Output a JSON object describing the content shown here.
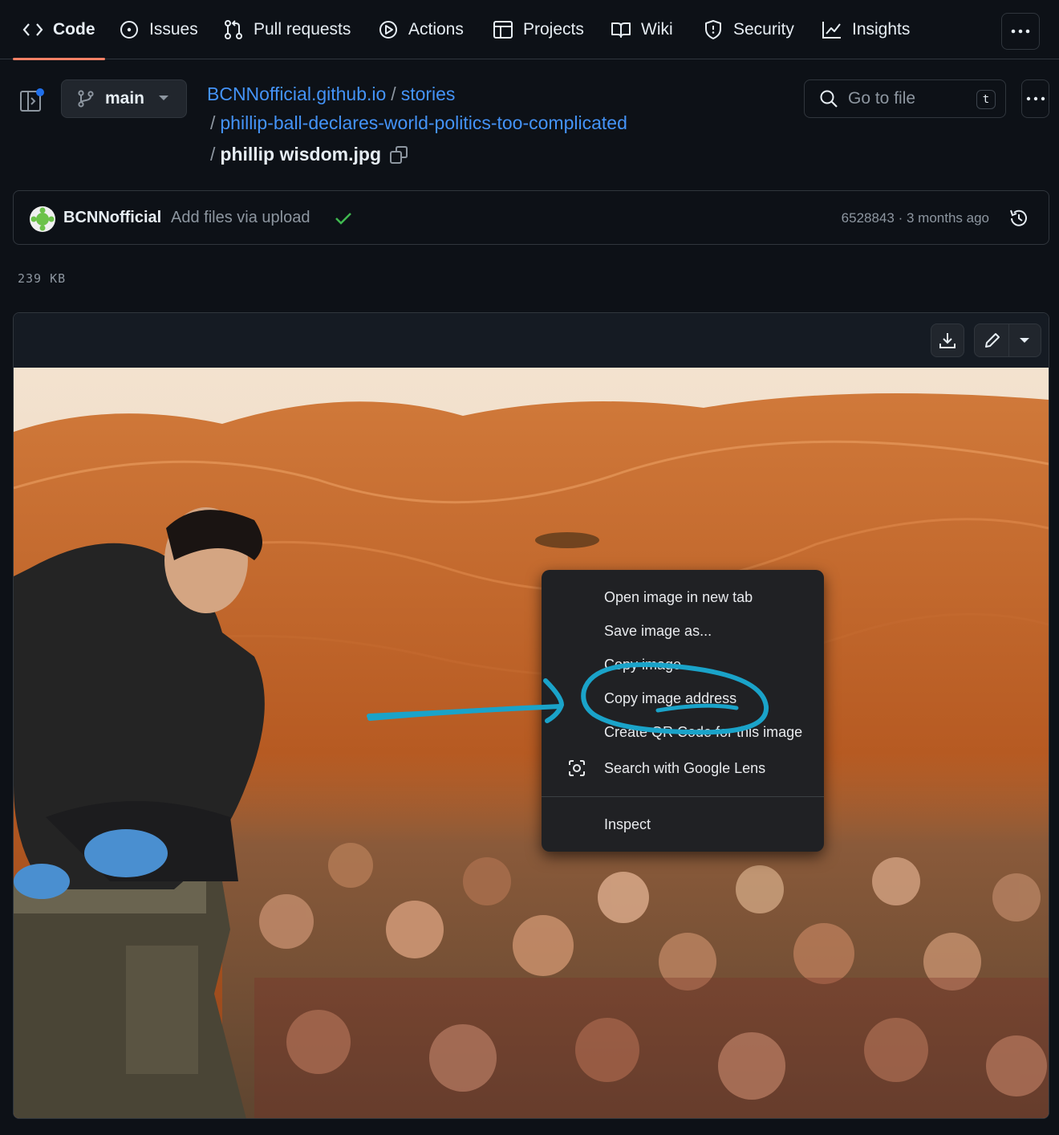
{
  "nav": {
    "tabs": [
      {
        "label": "Code",
        "icon": "code-icon",
        "active": true
      },
      {
        "label": "Issues",
        "icon": "issue-icon"
      },
      {
        "label": "Pull requests",
        "icon": "pull-request-icon"
      },
      {
        "label": "Actions",
        "icon": "play-icon"
      },
      {
        "label": "Projects",
        "icon": "table-icon"
      },
      {
        "label": "Wiki",
        "icon": "book-icon"
      },
      {
        "label": "Security",
        "icon": "shield-icon"
      },
      {
        "label": "Insights",
        "icon": "graph-icon"
      }
    ]
  },
  "branch": {
    "name": "main"
  },
  "breadcrumb": {
    "repo": "BCNNofficial.github.io",
    "sep": "/",
    "folder": "stories",
    "subfolder": "phillip-ball-declares-world-politics-too-complicated",
    "file": "phillip wisdom.jpg"
  },
  "search": {
    "placeholder": "Go to file",
    "shortcut": "t"
  },
  "commit": {
    "author": "BCNNofficial",
    "message": "Add files via upload",
    "sha": "6528843",
    "dot": "·",
    "time": "3 months ago"
  },
  "file": {
    "size": "239 KB"
  },
  "context_menu": {
    "items": [
      {
        "label": "Open image in new tab"
      },
      {
        "label": "Save image as..."
      },
      {
        "label": "Copy image"
      },
      {
        "label": "Copy image address"
      },
      {
        "label": "Create QR Code for this image"
      },
      {
        "label": "Search with Google Lens",
        "icon": "lens-icon"
      },
      {
        "label": "Inspect"
      }
    ]
  },
  "colors": {
    "accent_link": "#4493f8",
    "tab_underline": "#f78166",
    "annotation": "#1aa3c9",
    "check": "#3fb950"
  }
}
